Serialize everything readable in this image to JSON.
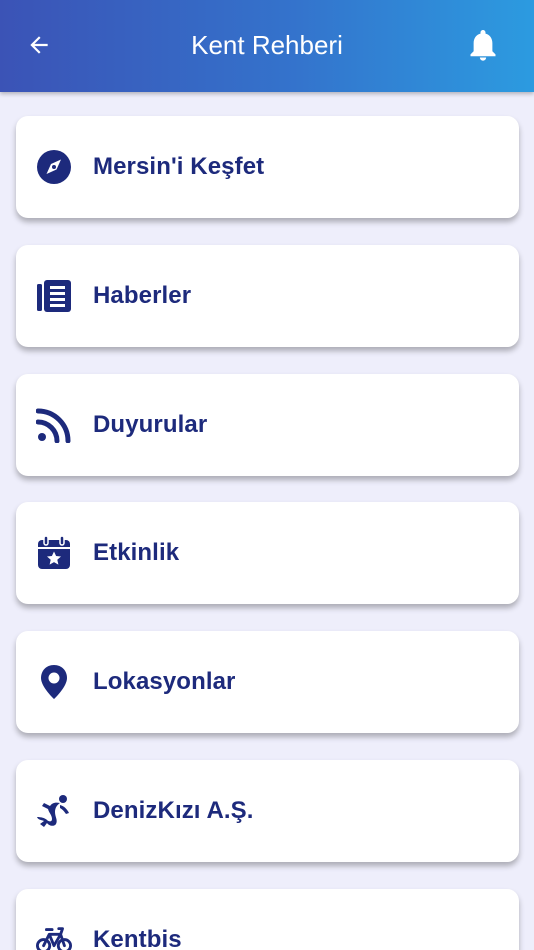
{
  "app_bar": {
    "title": "Kent Rehberi",
    "back_icon": "arrow-left-icon",
    "notification_icon": "bell-icon"
  },
  "colors": {
    "app_bar_gradient_start": "#3b53b6",
    "app_bar_gradient_end": "#2c9be0",
    "accent": "#1d2a7c",
    "card_background": "#ffffff",
    "page_background": "#eeeefb"
  },
  "menu": {
    "items": [
      {
        "label": "Mersin'i Keşfet",
        "icon": "compass-icon"
      },
      {
        "label": "Haberler",
        "icon": "newspaper-icon"
      },
      {
        "label": "Duyurular",
        "icon": "rss-feed-icon"
      },
      {
        "label": "Etkinlik",
        "icon": "calendar-star-icon"
      },
      {
        "label": "Lokasyonlar",
        "icon": "location-pin-icon"
      },
      {
        "label": "DenizKızı A.Ş.",
        "icon": "mermaid-icon"
      },
      {
        "label": "Kentbis",
        "icon": "bicycle-icon"
      }
    ]
  }
}
